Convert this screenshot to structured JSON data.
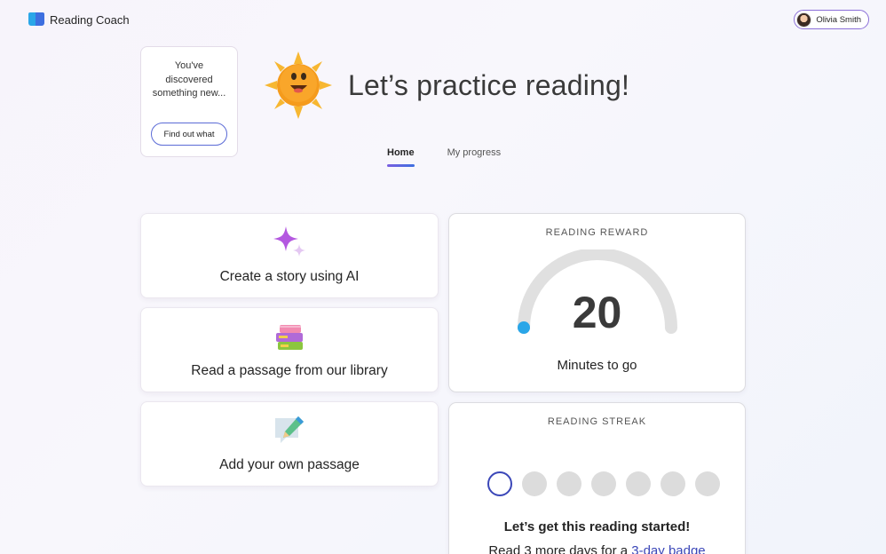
{
  "app": {
    "name": "Reading Coach"
  },
  "user": {
    "name": "Olivia Smith"
  },
  "discover": {
    "text": "You've discovered something new...",
    "button_label": "Find out what"
  },
  "hero": {
    "title": "Let’s practice reading!"
  },
  "tabs": [
    {
      "label": "Home",
      "active": true
    },
    {
      "label": "My progress",
      "active": false
    }
  ],
  "cards": [
    {
      "label": "Create a story using AI",
      "icon": "sparkle-icon"
    },
    {
      "label": "Read a passage from our library",
      "icon": "books-icon"
    },
    {
      "label": "Add your own passage",
      "icon": "pencil-note-icon"
    }
  ],
  "reward": {
    "title": "READING REWARD",
    "value": "20",
    "caption": "Minutes to go",
    "progress_fraction": 0.0
  },
  "streak": {
    "title": "READING STREAK",
    "days_total": 7,
    "headline": "Let’s get this reading started!",
    "sub_prefix": "Read 3 more days for a ",
    "sub_link": "3-day badge"
  },
  "colors": {
    "accent": "#3b47b8",
    "gauge_track": "#e0e0e0",
    "gauge_fill": "#2aa6e8",
    "sun": "#f7a928"
  }
}
